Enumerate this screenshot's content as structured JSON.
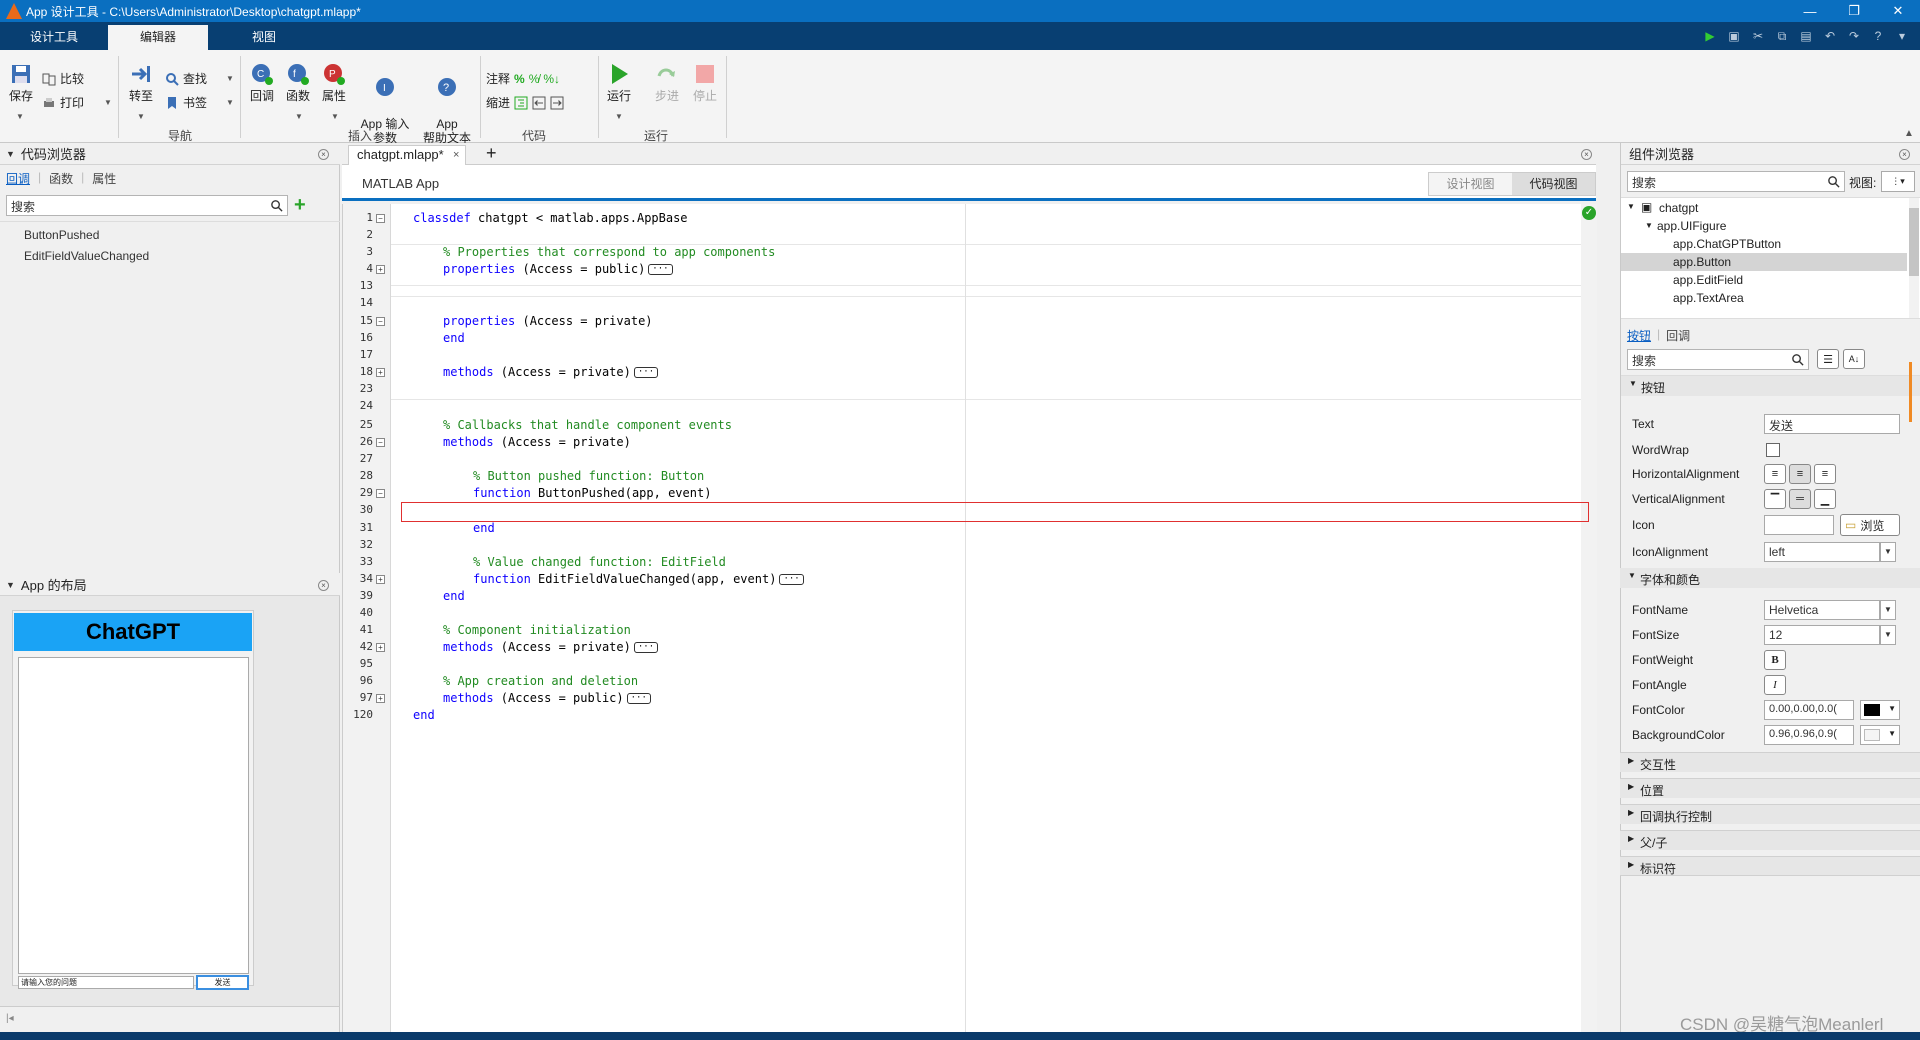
{
  "window": {
    "title": "App 设计工具 - C:\\Users\\Administrator\\Desktop\\chatgpt.mlapp*"
  },
  "tabs": [
    {
      "label": "设计工具"
    },
    {
      "label": "编辑器"
    },
    {
      "label": "视图"
    }
  ],
  "ribbon": {
    "save": "保存",
    "compare": "比较",
    "print": "打印",
    "goto": "转至",
    "find": "查找",
    "bookmark": "书签",
    "nav_group": "导航",
    "callback": "回调",
    "function": "函数",
    "property": "属性",
    "app_input_args": "App 输入\n参数",
    "app_help": "App\n帮助文本",
    "insert_group": "插入",
    "comment": "注释",
    "indent": "缩进",
    "code_group": "代码",
    "run": "运行",
    "step": "步进",
    "stop": "停止",
    "run_group": "运行"
  },
  "code_browser": {
    "title": "代码浏览器",
    "tabs": [
      "回调",
      "函数",
      "属性"
    ],
    "search_placeholder": "搜索",
    "items": [
      "ButtonPushed",
      "EditFieldValueChanged"
    ]
  },
  "app_layout": {
    "title": "App 的布局",
    "preview_button": "ChatGPT",
    "preview_input": "请输入您的问题",
    "preview_send": "发送"
  },
  "editor": {
    "file_tab": "chatgpt.mlapp*",
    "app_label": "MATLAB App",
    "design_view": "设计视图",
    "code_view": "代码视图",
    "line_numbers": [
      "1",
      "2",
      "3",
      "4",
      "13",
      "14",
      "15",
      "16",
      "17",
      "18",
      "23",
      "24",
      "25",
      "26",
      "27",
      "28",
      "29",
      "30",
      "31",
      "32",
      "33",
      "34",
      "39",
      "40",
      "41",
      "42",
      "95",
      "96",
      "97",
      "120"
    ]
  },
  "component_browser": {
    "title": "组件浏览器",
    "search_placeholder": "搜索",
    "view_label": "视图:",
    "tree": [
      "chatgpt",
      "app.UIFigure",
      "app.ChatGPTButton",
      "app.Button",
      "app.EditField",
      "app.TextArea"
    ],
    "subtabs": [
      "按钮",
      "回调"
    ],
    "search2_placeholder": "搜索",
    "section_button": "按钮",
    "props": {
      "text_label": "Text",
      "text_value": "发送",
      "wordwrap_label": "WordWrap",
      "halign_label": "HorizontalAlignment",
      "valign_label": "VerticalAlignment",
      "icon_label": "Icon",
      "browse": "浏览",
      "iconalign_label": "IconAlignment",
      "iconalign_value": "left"
    },
    "section_font": "字体和颜色",
    "font": {
      "fontname_label": "FontName",
      "fontname_value": "Helvetica",
      "fontsize_label": "FontSize",
      "fontsize_value": "12",
      "fontweight_label": "FontWeight",
      "fontweight_btn": "B",
      "fontangle_label": "FontAngle",
      "fontangle_btn": "I",
      "fontcolor_label": "FontColor",
      "fontcolor_value": "0.00,0.00,0.0(",
      "bgcolor_label": "BackgroundColor",
      "bgcolor_value": "0.96,0.96,0.9(",
      "fontcolor_swatch": "#000000",
      "bgcolor_swatch": "#f5f5f5"
    },
    "collapsed_sections": [
      "交互性",
      "位置",
      "回调执行控制",
      "父/子",
      "标识符"
    ]
  },
  "watermark": "CSDN @吴糖气泡Meanlerl",
  "colors": {
    "accent": "#0a6fc0",
    "tabbar": "#083f72",
    "chatgpt_btn": "#1aa3f5"
  }
}
